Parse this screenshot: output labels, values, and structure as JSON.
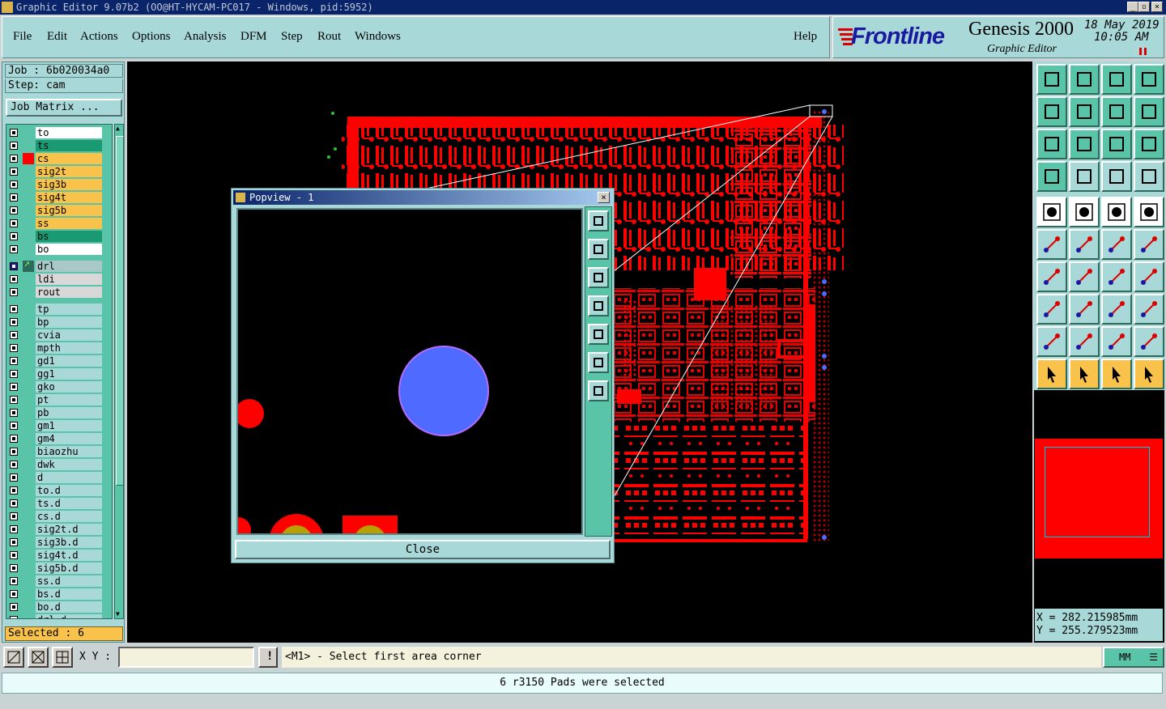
{
  "window": {
    "title": "Graphic Editor 9.07b2 (OO@HT-HYCAM-PC017 - Windows, pid:5952)"
  },
  "menu": {
    "items": [
      "File",
      "Edit",
      "Actions",
      "Options",
      "Analysis",
      "DFM",
      "Step",
      "Rout",
      "Windows"
    ],
    "help": "Help"
  },
  "brand": {
    "logo": "Frontline",
    "product": "Genesis 2000",
    "subtitle": "Graphic Editor",
    "date": "18 May 2019",
    "time": "10:05 AM"
  },
  "job": {
    "job_label": "Job : 6b020034a0",
    "step_label": "Step: cam",
    "matrix_button": "Job Matrix ..."
  },
  "layers": [
    {
      "name": "to",
      "color": "#ffffff",
      "swatch": ""
    },
    {
      "name": "ts",
      "color": "#1a9a73",
      "swatch": ""
    },
    {
      "name": "cs",
      "color": "#f9c24a",
      "swatch": "#ff0000"
    },
    {
      "name": "sig2t",
      "color": "#f9c24a",
      "swatch": ""
    },
    {
      "name": "sig3b",
      "color": "#f9c24a",
      "swatch": ""
    },
    {
      "name": "sig4t",
      "color": "#f9c24a",
      "swatch": ""
    },
    {
      "name": "sig5b",
      "color": "#f9c24a",
      "swatch": ""
    },
    {
      "name": "ss",
      "color": "#f9c24a",
      "swatch": ""
    },
    {
      "name": "bs",
      "color": "#1a9a73",
      "swatch": ""
    },
    {
      "name": "bo",
      "color": "#ffffff",
      "swatch": ""
    },
    {
      "name": "drl",
      "color": "#a9c8c8",
      "swatch": "#ffffff",
      "active": true
    },
    {
      "name": "ldi",
      "color": "#d8d8d8",
      "swatch": ""
    },
    {
      "name": "rout",
      "color": "#d8d8d8",
      "swatch": ""
    },
    {
      "name": "tp",
      "color": "#a9d8d8",
      "swatch": ""
    },
    {
      "name": "bp",
      "color": "#a9d8d8",
      "swatch": ""
    },
    {
      "name": "cvia",
      "color": "#a9d8d8",
      "swatch": ""
    },
    {
      "name": "mpth",
      "color": "#a9d8d8",
      "swatch": ""
    },
    {
      "name": "gd1",
      "color": "#a9d8d8",
      "swatch": ""
    },
    {
      "name": "gg1",
      "color": "#a9d8d8",
      "swatch": ""
    },
    {
      "name": "gko",
      "color": "#a9d8d8",
      "swatch": ""
    },
    {
      "name": "pt",
      "color": "#a9d8d8",
      "swatch": ""
    },
    {
      "name": "pb",
      "color": "#a9d8d8",
      "swatch": ""
    },
    {
      "name": "gm1",
      "color": "#a9d8d8",
      "swatch": ""
    },
    {
      "name": "gm4",
      "color": "#a9d8d8",
      "swatch": ""
    },
    {
      "name": "biaozhu",
      "color": "#a9d8d8",
      "swatch": ""
    },
    {
      "name": "dwk",
      "color": "#a9d8d8",
      "swatch": ""
    },
    {
      "name": "d",
      "color": "#a9d8d8",
      "swatch": ""
    },
    {
      "name": "to.d",
      "color": "#a9d8d8",
      "swatch": ""
    },
    {
      "name": "ts.d",
      "color": "#a9d8d8",
      "swatch": ""
    },
    {
      "name": "cs.d",
      "color": "#a9d8d8",
      "swatch": ""
    },
    {
      "name": "sig2t.d",
      "color": "#a9d8d8",
      "swatch": ""
    },
    {
      "name": "sig3b.d",
      "color": "#a9d8d8",
      "swatch": ""
    },
    {
      "name": "sig4t.d",
      "color": "#a9d8d8",
      "swatch": ""
    },
    {
      "name": "sig5b.d",
      "color": "#a9d8d8",
      "swatch": ""
    },
    {
      "name": "ss.d",
      "color": "#a9d8d8",
      "swatch": ""
    },
    {
      "name": "bs.d",
      "color": "#a9d8d8",
      "swatch": ""
    },
    {
      "name": "bo.d",
      "color": "#a9d8d8",
      "swatch": ""
    },
    {
      "name": "drl.d",
      "color": "#a9d8d8",
      "swatch": ""
    }
  ],
  "selected_label": "Selected : 6",
  "popview": {
    "title": "Popview - 1",
    "close_button": "Close"
  },
  "coords": {
    "x": "X = 282.215985mm",
    "y": "Y = 255.279523mm"
  },
  "bottom": {
    "xy_label": "X Y :",
    "prompt": "<M1> - Select first area corner",
    "units": "MM"
  },
  "status": "6 r3150 Pads were selected",
  "colors": {
    "copper": "#ff0000",
    "drill": "#4f6bff",
    "pad_fill": "#b8a000",
    "panel": "#a9d8d8",
    "layer_green": "#59c4a8",
    "highlight": "#f9c24a"
  }
}
